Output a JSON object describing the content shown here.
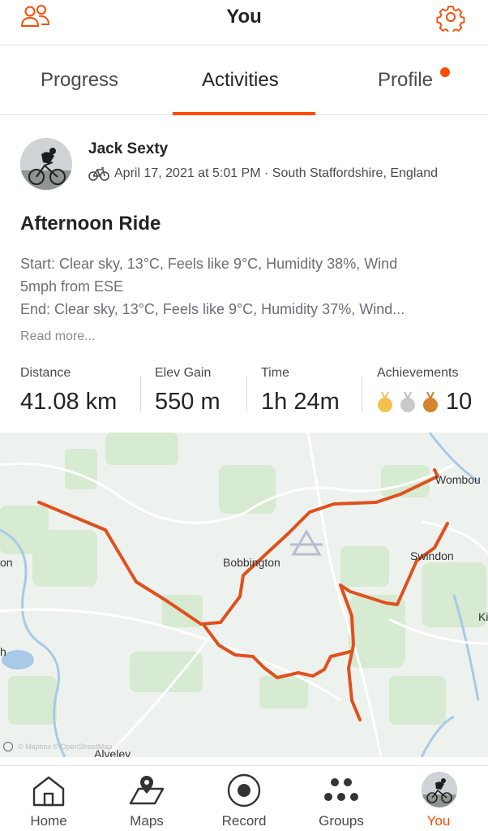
{
  "header": {
    "title": "You",
    "left_icon": "athletes-icon",
    "right_icon": "settings-gear-icon"
  },
  "tabs": [
    {
      "label": "Progress"
    },
    {
      "label": "Activities",
      "active": true
    },
    {
      "label": "Profile",
      "notification": true
    }
  ],
  "activity": {
    "athlete_name": "Jack Sexty",
    "sport_icon": "bike-icon",
    "datetime_location": "April 17, 2021 at 5:01 PM · South Staffordshire, England",
    "title": "Afternoon Ride",
    "description_lines": [
      "Start: Clear sky, 13°C, Feels like 9°C, Humidity 38%, Wind",
      "5mph from ESE",
      "End: Clear sky, 13°C, Feels like 9°C, Humidity 37%, Wind..."
    ],
    "read_more": "Read more...",
    "stats": {
      "distance": {
        "label": "Distance",
        "value": "41.08 km"
      },
      "elev_gain": {
        "label": "Elev Gain",
        "value": "550 m"
      },
      "time": {
        "label": "Time",
        "value": "1h 24m"
      },
      "achievements": {
        "label": "Achievements",
        "value": "10",
        "medals": [
          "gold",
          "silver",
          "bronze"
        ]
      }
    }
  },
  "map": {
    "place_labels": [
      "Wombou",
      "Bobbington",
      "Swindon",
      "Alveley",
      "on",
      "h",
      "Ki"
    ],
    "attribution": "© Mapbox © OpenStreetMap",
    "route_color": "#e0501d"
  },
  "colors": {
    "accent": "#fc4c02",
    "gold": "#f2c14e",
    "silver": "#c9c9c9",
    "bronze": "#d4862f"
  },
  "bottom_nav": [
    {
      "label": "Home",
      "icon": "home-icon"
    },
    {
      "label": "Maps",
      "icon": "map-icon"
    },
    {
      "label": "Record",
      "icon": "record-icon"
    },
    {
      "label": "Groups",
      "icon": "groups-icon"
    },
    {
      "label": "You",
      "icon": "avatar",
      "active": true
    }
  ]
}
